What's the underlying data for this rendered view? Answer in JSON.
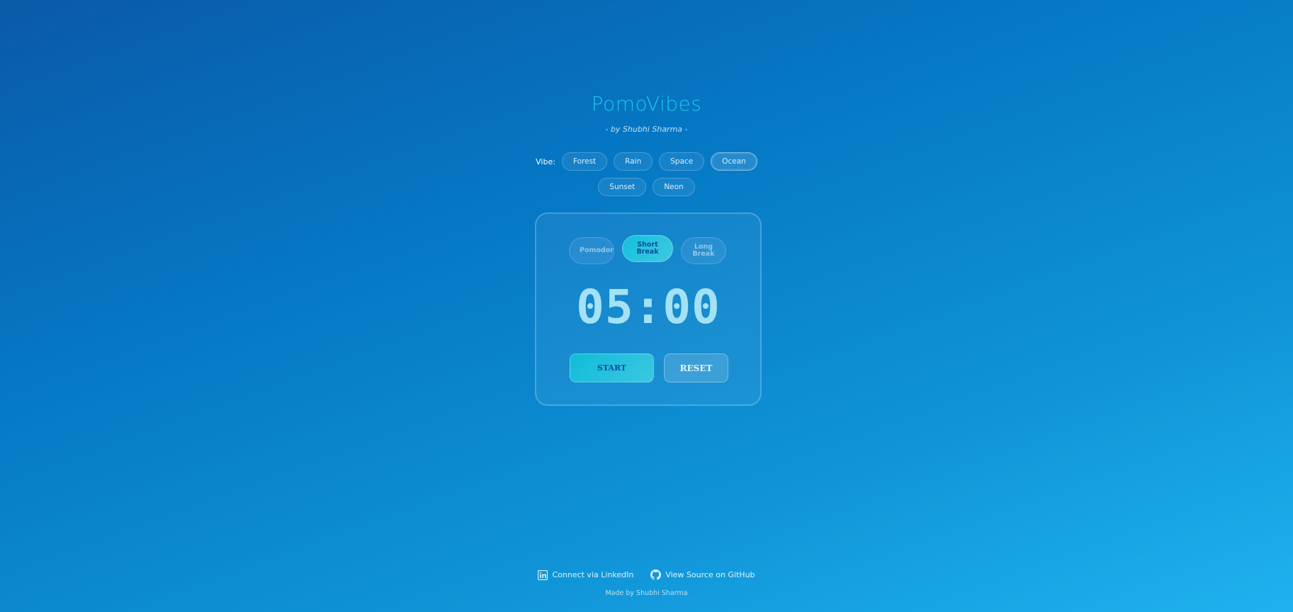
{
  "app": {
    "title": "PomoVibes",
    "subtitle": "- by Shubhi Sharma -"
  },
  "vibes": {
    "label": "Vibe:",
    "options": [
      "Forest",
      "Rain",
      "Space",
      "Ocean",
      "Sunset",
      "Neon"
    ],
    "selected": "Ocean"
  },
  "timer": {
    "modes": [
      "Pomodoro",
      "Short Break",
      "Long Break"
    ],
    "active_mode": "Short Break",
    "display": "05:00",
    "start_label": "START",
    "reset_label": "RESET"
  },
  "footer": {
    "linkedin_label": "Connect via LinkedIn",
    "github_label": "View Source on GitHub",
    "made_by": "Made by Shubhi Sharma"
  },
  "colors": {
    "accent": "#1ec6e6",
    "background_start": "#0a5aa8",
    "background_end": "#1fb2f0"
  },
  "icons": {
    "linkedin": "linkedin-icon",
    "github": "github-icon"
  }
}
